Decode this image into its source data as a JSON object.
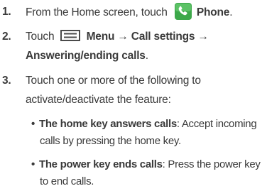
{
  "steps": [
    {
      "number": "1.",
      "line1_pre": "From the Home screen, touch",
      "line1_icon": "phone-icon",
      "line1_bold": "Phone",
      "line1_post": "."
    },
    {
      "number": "2.",
      "line1_pre": "Touch",
      "line1_icon": "menu-icon",
      "line1_bold": "Menu → Call settings →",
      "line2_bold": "Answering/ending calls",
      "line2_post": "."
    },
    {
      "number": "3.",
      "line1": "Touch one or more of the following to",
      "line2": "activate/deactivate the feature:"
    }
  ],
  "bullets": [
    {
      "bullet": "•",
      "title": "The home key answers calls",
      "desc_line1": ": Accept incoming",
      "desc_line2": "calls by pressing the home key."
    },
    {
      "bullet": "•",
      "title": "The power key ends calls",
      "desc_line1": ": Press the power key",
      "desc_line2": "to end calls."
    }
  ],
  "colors": {
    "text": "#3a3a3a",
    "phone_icon_bg": "#3da84a",
    "menu_icon": "#4a4a4a"
  }
}
